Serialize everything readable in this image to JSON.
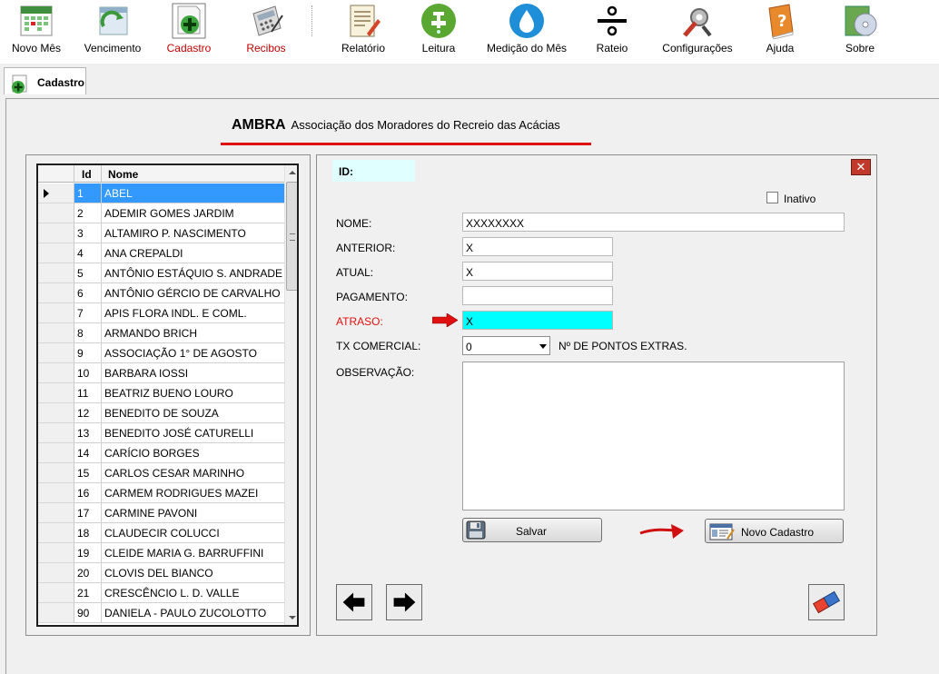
{
  "toolbar": {
    "items": [
      {
        "label": "Novo Mês",
        "icon": "calendar-icon"
      },
      {
        "label": "Vencimento",
        "icon": "recurring-calendar-icon"
      },
      {
        "label": "Cadastro",
        "icon": "add-document-icon"
      },
      {
        "label": "Recibos",
        "icon": "calculator-icon"
      },
      {
        "label": "Relatório",
        "icon": "report-icon"
      },
      {
        "label": "Leitura",
        "icon": "faucet-icon"
      },
      {
        "label": "Medição do Mês",
        "icon": "water-drop-icon"
      },
      {
        "label": "Rateio",
        "icon": "division-icon"
      },
      {
        "label": "Configurações",
        "icon": "tools-icon"
      },
      {
        "label": "Ajuda",
        "icon": "help-book-icon"
      },
      {
        "label": "Sobre",
        "icon": "about-cd-icon"
      }
    ]
  },
  "tab": {
    "label": "Cadastro"
  },
  "header": {
    "abbr": "AMBRA",
    "name": "Associação dos Moradores do Recreio das Acácias"
  },
  "grid": {
    "col_id": "Id",
    "col_name": "Nome",
    "rows": [
      {
        "id": "1",
        "name": "ABEL"
      },
      {
        "id": "2",
        "name": "ADEMIR GOMES JARDIM"
      },
      {
        "id": "3",
        "name": "ALTAMIRO P. NASCIMENTO"
      },
      {
        "id": "4",
        "name": "ANA CREPALDI"
      },
      {
        "id": "5",
        "name": "ANTÔNIO ESTÁQUIO S. ANDRADE"
      },
      {
        "id": "6",
        "name": "ANTÔNIO GÉRCIO DE CARVALHO"
      },
      {
        "id": "7",
        "name": "APIS FLORA INDL. E COML."
      },
      {
        "id": "8",
        "name": "ARMANDO BRICH"
      },
      {
        "id": "9",
        "name": "ASSOCIAÇÃO 1° DE AGOSTO"
      },
      {
        "id": "10",
        "name": "BARBARA IOSSI"
      },
      {
        "id": "11",
        "name": "BEATRIZ BUENO LOURO"
      },
      {
        "id": "12",
        "name": "BENEDITO DE SOUZA"
      },
      {
        "id": "13",
        "name": "BENEDITO JOSÉ CATURELLI"
      },
      {
        "id": "14",
        "name": "CARÍCIO BORGES"
      },
      {
        "id": "15",
        "name": "CARLOS CESAR MARINHO"
      },
      {
        "id": "16",
        "name": "CARMEM RODRIGUES MAZEI"
      },
      {
        "id": "17",
        "name": "CARMINE PAVONI"
      },
      {
        "id": "18",
        "name": "CLAUDECIR COLUCCI"
      },
      {
        "id": "19",
        "name": "CLEIDE MARIA G. BARRUFFINI"
      },
      {
        "id": "20",
        "name": "CLOVIS DEL BIANCO"
      },
      {
        "id": "21",
        "name": "CRESCÊNCIO L. D. VALLE"
      },
      {
        "id": "90",
        "name": "DANIELA - PAULO ZUCOLOTTO"
      }
    ]
  },
  "form": {
    "id_label": "ID:",
    "inativo_label": "Inativo",
    "nome_label": "NOME:",
    "nome_value": "XXXXXXXX",
    "anterior_label": "ANTERIOR:",
    "anterior_value": "X",
    "atual_label": "ATUAL:",
    "atual_value": "X",
    "pagamento_label": "PAGAMENTO:",
    "pagamento_value": "",
    "atraso_label": "ATRASO:",
    "atraso_value": "X",
    "tx_label": "TX COMERCIAL:",
    "tx_value": "0",
    "pontos_label": "Nº DE PONTOS EXTRAS.",
    "obs_label": "OBSERVAÇÃO:",
    "obs_value": "",
    "salvar_label": "Salvar",
    "novo_label": "Novo Cadastro"
  },
  "colors": {
    "accent_red": "#e01010",
    "highlight_cyan": "#00ffff",
    "selection_blue": "#3399ff"
  }
}
